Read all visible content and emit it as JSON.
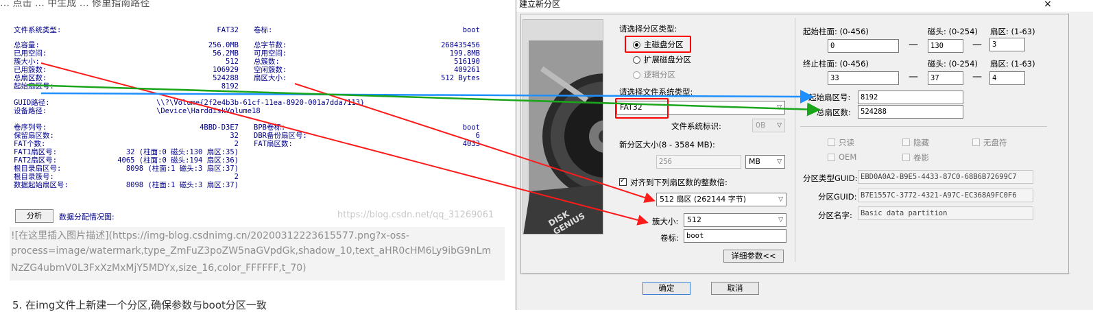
{
  "left": {
    "top_cut": "… 点击 … 中生成 … 修里指南路径",
    "block1": [
      {
        "label": "文件系统类型:",
        "value": "FAT32",
        "label2": "卷标:",
        "value2": "boot"
      }
    ],
    "block2": [
      {
        "label": "总容量:",
        "value": "256.0MB",
        "label2": "总字节数:",
        "value2": "268435456"
      },
      {
        "label": "已用空间:",
        "value": "56.2MB",
        "label2": "可用空间:",
        "value2": "199.8MB"
      },
      {
        "label": "簇大小:",
        "value": "512",
        "label2": "总簇数:",
        "value2": "516190"
      },
      {
        "label": "已用簇数:",
        "value": "106929",
        "label2": "空闲簇数:",
        "value2": "409261"
      },
      {
        "label": "总扇区数:",
        "value": "524288",
        "label2": "扇区大小:",
        "value2": "512 Bytes"
      },
      {
        "label": "起始扇区号:",
        "value": "8192",
        "label2": "",
        "value2": ""
      }
    ],
    "guid_label": "GUID路径:",
    "guid_value": "\\\\?\\Volume{2f2e4b3b-61cf-11ea-8920-001a7dda7113}",
    "device_label": "设备路径:",
    "device_value": "\\Device\\HarddiskVolume18",
    "block3": [
      {
        "label": "卷序列号:",
        "value": "4BBD-D3E7",
        "label2": "BPB卷标:",
        "value2": "boot"
      },
      {
        "label": "保留扇区数:",
        "value": "32",
        "label2": "DBR备份扇区号:",
        "value2": "6"
      },
      {
        "label": "FAT个数:",
        "value": "2",
        "label2": "FAT扇区数:",
        "value2": "4033"
      },
      {
        "label": "FAT1扇区号:",
        "value": "32 (柱面:0 磁头:130 扇区:35)",
        "label2": "",
        "value2": ""
      },
      {
        "label": "FAT2扇区号:",
        "value": "4065 (柱面:0 磁头:194 扇区:36)",
        "label2": "",
        "value2": ""
      },
      {
        "label": "根目录扇区号:",
        "value": "8098 (柱面:1 磁头:3 扇区:37)",
        "label2": "",
        "value2": ""
      },
      {
        "label": "根目录簇号:",
        "value": "2",
        "label2": "",
        "value2": ""
      },
      {
        "label": "数据起始扇区号:",
        "value": "8098 (柱面:1 磁头:3 扇区:37)",
        "label2": "",
        "value2": ""
      }
    ],
    "analyze_button": "分析",
    "alloc_label": "数据分配情况图:",
    "watermark": "https://blog.csdn.net/qq_31269061",
    "md_lines": [
      "![在这里插入图片描述](https://img-blog.csdnimg.cn/20200312223615577.png?x-oss-",
      "process=image/watermark,type_ZmFuZ3poZW5naGVpdGk,shadow_10,text_aHR0cHM6Ly9ibG9nLm",
      "NzZG4ubmV0L3FxXzMxMjY5MDYx,size_16,color_FFFFFF,t_70)"
    ],
    "step_text": "5. 在img文件上新建一个分区,确保参数与boot分区一致"
  },
  "dialog": {
    "title": "建立新分区",
    "close_icon": "×",
    "partition_type_label": "请选择分区类型:",
    "radio_primary": "主磁盘分区",
    "radio_extended": "扩展磁盘分区",
    "radio_logical": "逻辑分区",
    "fs_type_label": "请选择文件系统类型:",
    "fs_type_value": "FAT32",
    "fs_id_label": "文件系统标识:",
    "fs_id_value": "0B",
    "size_label": "新分区大小(8 - 3584 MB):",
    "size_value": "256",
    "size_unit": "MB",
    "align_label": "对齐到下列扇区数的整数倍:",
    "align_value": "512 扇区 (262144 字节)",
    "cluster_label": "簇大小:",
    "cluster_value": "512",
    "volume_label": "卷标:",
    "volume_value": "boot",
    "detail_button": "详细参数<<",
    "start_cyl_label": "起始柱面: (0-456)",
    "start_head_label": "磁头: (0-254)",
    "start_sector_label": "扇区: (1-63)",
    "start_cyl": "0",
    "start_head": "130",
    "start_sector": "3",
    "end_cyl_label": "终止柱面: (0-456)",
    "end_head_label": "磁头: (0-254)",
    "end_sector_label": "扇区: (1-63)",
    "end_cyl": "33",
    "end_head": "37",
    "end_sector": "4",
    "dash": "—",
    "start_lba_label": "起始扇区号:",
    "start_lba": "8192",
    "total_sectors_label": "总扇区数:",
    "total_sectors": "524288",
    "cb_readonly": "只读",
    "cb_hidden": "隐藏",
    "cb_nodrive": "无盘符",
    "cb_oem": "OEM",
    "cb_shadow": "卷影",
    "type_guid_label": "分区类型GUID:",
    "type_guid": "EBD0A0A2-B9E5-4433-87C0-68B6B72699C7",
    "part_guid_label": "分区GUID:",
    "part_guid": "B7E1557C-3772-4321-A97C-EC368A9FC0F6",
    "part_name_label": "分区名字:",
    "part_name": "Basic data partition",
    "ok_button": "确定",
    "cancel_button": "取消",
    "disk_brand": "DISK GENIUS"
  },
  "colors": {
    "red_arrow": "#ff1a1a",
    "blue_arrow": "#1e8fff",
    "green_arrow": "#1aa51a",
    "label_blue": "#00008b"
  }
}
